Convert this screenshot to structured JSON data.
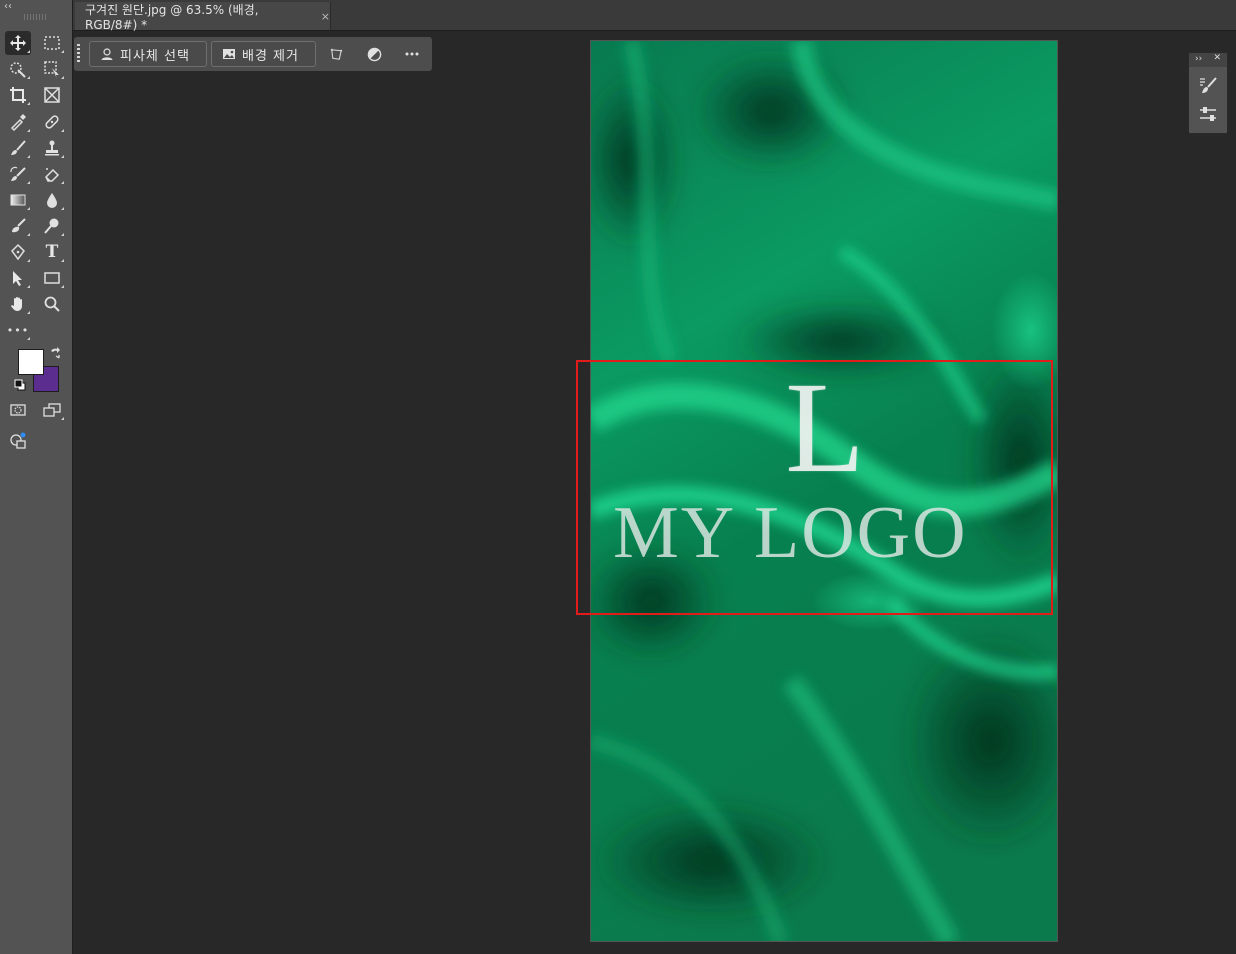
{
  "document": {
    "tab_title": "구겨진 원단.jpg @ 63.5% (배경, RGB/8#) *",
    "close_symbol": "×"
  },
  "toolbar": {
    "collapse_symbol": "‹‹",
    "tools": [
      {
        "name": "move-tool",
        "icon": "move-arrows-icon",
        "active": true
      },
      {
        "name": "marquee-tool",
        "icon": "rectangular-marquee-icon"
      },
      {
        "name": "quick-selection-tool",
        "icon": "quick-selection-icon"
      },
      {
        "name": "object-selection-tool",
        "icon": "object-selection-icon"
      },
      {
        "name": "crop-tool",
        "icon": "crop-icon"
      },
      {
        "name": "frame-tool",
        "icon": "frame-icon"
      },
      {
        "name": "eyedropper-tool",
        "icon": "eyedropper-icon"
      },
      {
        "name": "spot-healing-tool",
        "icon": "healing-brush-icon"
      },
      {
        "name": "brush-tool",
        "icon": "brush-icon"
      },
      {
        "name": "clone-stamp-tool",
        "icon": "stamp-icon"
      },
      {
        "name": "history-brush-tool",
        "icon": "history-brush-icon"
      },
      {
        "name": "eraser-tool",
        "icon": "eraser-icon"
      },
      {
        "name": "gradient-tool",
        "icon": "gradient-icon"
      },
      {
        "name": "blur-tool",
        "icon": "blur-drop-icon"
      },
      {
        "name": "dodge-tool",
        "icon": "dodge-icon"
      },
      {
        "name": "smudge-tool",
        "icon": "smudge-icon"
      },
      {
        "name": "pen-tool",
        "icon": "pen-icon"
      },
      {
        "name": "type-tool",
        "icon": "type-icon",
        "label": "T"
      },
      {
        "name": "path-selection-tool",
        "icon": "path-selection-icon"
      },
      {
        "name": "rectangle-tool",
        "icon": "rectangle-icon"
      },
      {
        "name": "hand-tool",
        "icon": "hand-icon"
      },
      {
        "name": "zoom-tool",
        "icon": "zoom-icon"
      },
      {
        "name": "edit-toolbar",
        "icon": "more-icon",
        "label": "•••"
      }
    ],
    "foreground_color": "#ffffff",
    "background_color": "#5b2d8e"
  },
  "taskbar": {
    "select_subject_label": "피사체 선택",
    "remove_background_label": "배경 제거"
  },
  "canvas": {
    "logo_letter": "L",
    "logo_text": "MY LOGO",
    "fabric_color": "#0a8c5a",
    "selection_color": "#e21b1b"
  },
  "mini_panel": {
    "expand_symbol": "››",
    "close_symbol": "✕"
  }
}
